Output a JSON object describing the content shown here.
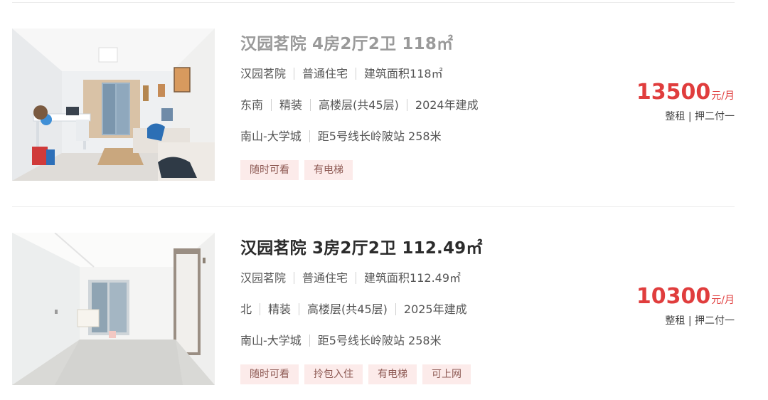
{
  "listings": [
    {
      "title": "汉园茗院 4房2厅2卫 118㎡",
      "community": "汉园茗院",
      "property_type": "普通住宅",
      "area": "建筑面积118㎡",
      "orientation": "东南",
      "decoration": "精装",
      "floor": "高楼层(共45层)",
      "built_year": "2024年建成",
      "district": "南山-大学城",
      "subway": "距5号线长岭陂站 258米",
      "tags": [
        "随时可看",
        "有电梯"
      ],
      "price": "13500",
      "price_unit": "元/月",
      "rent_terms": "整租 | 押二付一"
    },
    {
      "title": "汉园茗院 3房2厅2卫 112.49㎡",
      "community": "汉园茗院",
      "property_type": "普通住宅",
      "area": "建筑面积112.49㎡",
      "orientation": "北",
      "decoration": "精装",
      "floor": "高楼层(共45层)",
      "built_year": "2025年建成",
      "district": "南山-大学城",
      "subway": "距5号线长岭陂站 258米",
      "tags": [
        "随时可看",
        "拎包入住",
        "有电梯",
        "可上网"
      ],
      "price": "10300",
      "price_unit": "元/月",
      "rent_terms": "整租 | 押二付一"
    }
  ],
  "colors": {
    "price": "#e03d3d",
    "tag_background": "#fcebea",
    "tag_text": "#8e5a54",
    "visited_title": "#9a9a9a",
    "title": "#2b2b2b"
  }
}
